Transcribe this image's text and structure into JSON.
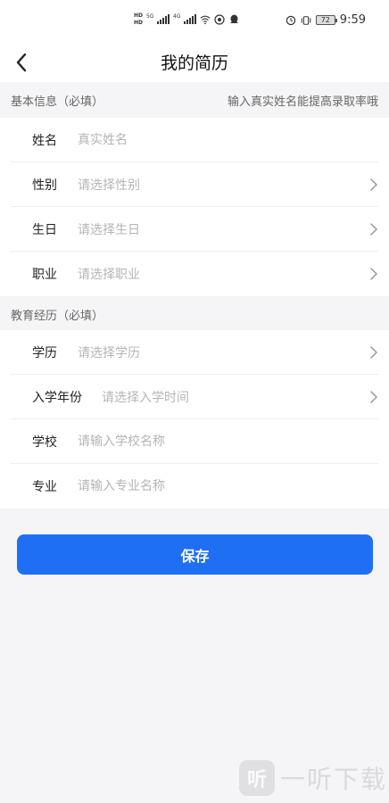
{
  "status_bar": {
    "hd_top": "HD",
    "hd_bottom": "HD",
    "network_1": "5G",
    "network_2": "4G",
    "battery": "72",
    "time": "9:59"
  },
  "nav": {
    "title": "我的简历"
  },
  "basic_section": {
    "title": "基本信息（必填）",
    "hint": "输入真实姓名能提高录取率哦",
    "fields": [
      {
        "label": "姓名",
        "placeholder": "真实姓名"
      },
      {
        "label": "性别",
        "placeholder": "请选择性别"
      },
      {
        "label": "生日",
        "placeholder": "请选择生日"
      },
      {
        "label": "职业",
        "placeholder": "请选择职业"
      }
    ]
  },
  "education_section": {
    "title": "教育经历（必填）",
    "fields": [
      {
        "label": "学历",
        "placeholder": "请选择学历"
      },
      {
        "label": "入学年份",
        "placeholder": "请选择入学时间"
      },
      {
        "label": "学校",
        "placeholder": "请输入学校名称"
      },
      {
        "label": "专业",
        "placeholder": "请输入专业名称"
      }
    ]
  },
  "save_label": "保存",
  "watermark": {
    "logo_char": "听",
    "text": "一听下载"
  },
  "colors": {
    "accent": "#1f6ff5",
    "page_background": "#f5f5f7",
    "placeholder_text": "#b5b5b5"
  },
  "icons": {
    "back": "chevron-left-icon",
    "row_arrow": "chevron-right-icon",
    "alarm": "alarm-icon",
    "vibrate": "vibrate-icon",
    "wifi": "wifi-icon",
    "qq": "qq-icon"
  }
}
